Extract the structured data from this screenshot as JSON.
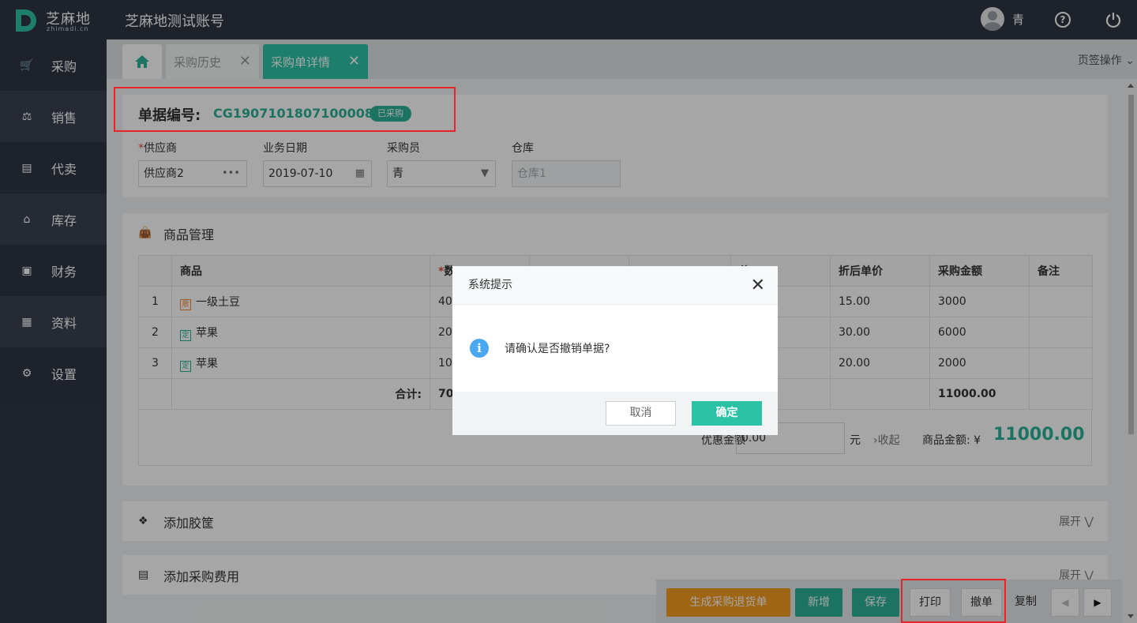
{
  "topbar": {
    "logo_text": "芝麻地",
    "logo_sub": "zhimadi.cn",
    "account_title": "芝麻地测试账号",
    "user_name": "青"
  },
  "sidebar": {
    "items": [
      {
        "label": "采购",
        "icon": "cart-icon"
      },
      {
        "label": "销售",
        "icon": "hand-cart-icon"
      },
      {
        "label": "代卖",
        "icon": "consign-icon"
      },
      {
        "label": "库存",
        "icon": "warehouse-icon"
      },
      {
        "label": "财务",
        "icon": "finance-icon"
      },
      {
        "label": "资料",
        "icon": "data-icon"
      },
      {
        "label": "设置",
        "icon": "gear-icon"
      }
    ]
  },
  "tabs": {
    "history": "采购历史",
    "detail": "采购单详情",
    "ops": "页签操作"
  },
  "doc": {
    "no_label": "单据编号:",
    "no_value": "CG190710180710000836",
    "status": "已采购"
  },
  "form": {
    "supplier_label": "供应商",
    "supplier_value": "供应商2",
    "date_label": "业务日期",
    "date_value": "2019-07-10",
    "buyer_label": "采购员",
    "buyer_value": "青",
    "warehouse_label": "仓库",
    "warehouse_placeholder": "仓库1"
  },
  "goods": {
    "title": "商品管理",
    "headers": [
      "",
      "商品",
      "*数",
      "",
      "",
      "价",
      "折后单价",
      "采购金额",
      "备注"
    ],
    "rows": [
      {
        "idx": "1",
        "tag": "散",
        "name": "一级土豆",
        "qty": "40",
        "net": "15.00",
        "amount": "3000"
      },
      {
        "idx": "2",
        "tag": "定",
        "name": "苹果",
        "qty": "20",
        "net": "30.00",
        "amount": "6000"
      },
      {
        "idx": "3",
        "tag": "定",
        "name": "苹果",
        "qty": "10",
        "net": "20.00",
        "amount": "2000"
      }
    ],
    "total_label": "合计:",
    "total_qty": "70",
    "total_amount": "11000.00",
    "discount_label": "优惠金额",
    "discount_value": "0.00",
    "unit": "元",
    "collapse": "收起",
    "amount_label": "商品金额:",
    "currency": "¥",
    "amount_value": "11000.00"
  },
  "sections": {
    "crate": "添加胶筐",
    "fee": "添加采购费用",
    "expand": "展开"
  },
  "actions": {
    "return": "生成采购退货单",
    "new": "新增",
    "save": "保存",
    "print": "打印",
    "revoke": "撤单",
    "copy": "复制"
  },
  "modal": {
    "title": "系统提示",
    "message": "请确认是否撤销单据?",
    "cancel": "取消",
    "ok": "确定"
  },
  "colors": {
    "accent": "#2cc2a5",
    "brand_dark": "#2f3542",
    "orange": "#f39c1f",
    "highlight": "#e5252a"
  }
}
